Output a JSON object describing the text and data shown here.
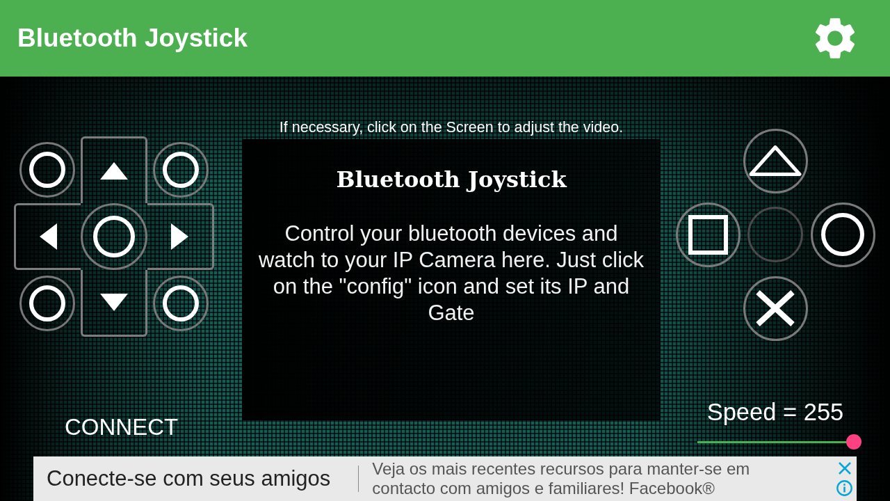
{
  "app_bar": {
    "title": "Bluetooth Joystick"
  },
  "video_panel": {
    "hint": "If necessary, click on the Screen to adjust the video.",
    "title": "Bluetooth Joystick",
    "message": "Control your bluetooth devices and watch to your IP Camera here. Just click on the \"config\" icon and set its IP and Gate"
  },
  "connect_button": {
    "label": "CONNECT"
  },
  "speed": {
    "label": "Speed = 255",
    "level": 1
  },
  "ad": {
    "headline": "Conecte-se com seus amigos",
    "text": "Veja os mais recentes recursos para manter-se em contacto com amigos e familiares! Facebook®"
  }
}
